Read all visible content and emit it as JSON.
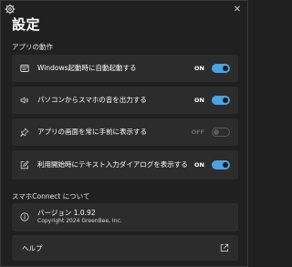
{
  "window": {
    "title": "設定",
    "close_label": "✕"
  },
  "sections": {
    "behavior": {
      "title": "アプリの動作",
      "items": [
        {
          "label": "Windows起動時に自動起動する",
          "state": "ON",
          "on": true,
          "icon": "window-icon"
        },
        {
          "label": "パソコンからスマホの音を出力する",
          "state": "ON",
          "on": true,
          "icon": "speaker-icon"
        },
        {
          "label": "アプリの画面を常に手前に表示する",
          "state": "OFF",
          "on": false,
          "icon": "pin-icon"
        },
        {
          "label": "利用開始時にテキスト入力ダイアログを表示する",
          "state": "ON",
          "on": true,
          "icon": "edit-icon"
        }
      ]
    },
    "about": {
      "title": "スマホConnect について",
      "version": "バージョン 1.0.92",
      "copyright": "Copyright 2024 GreenBee, Inc.",
      "help_label": "ヘルプ"
    }
  },
  "colors": {
    "accent": "#4da3e0",
    "background": "#202020",
    "card": "#2c2c2c"
  }
}
